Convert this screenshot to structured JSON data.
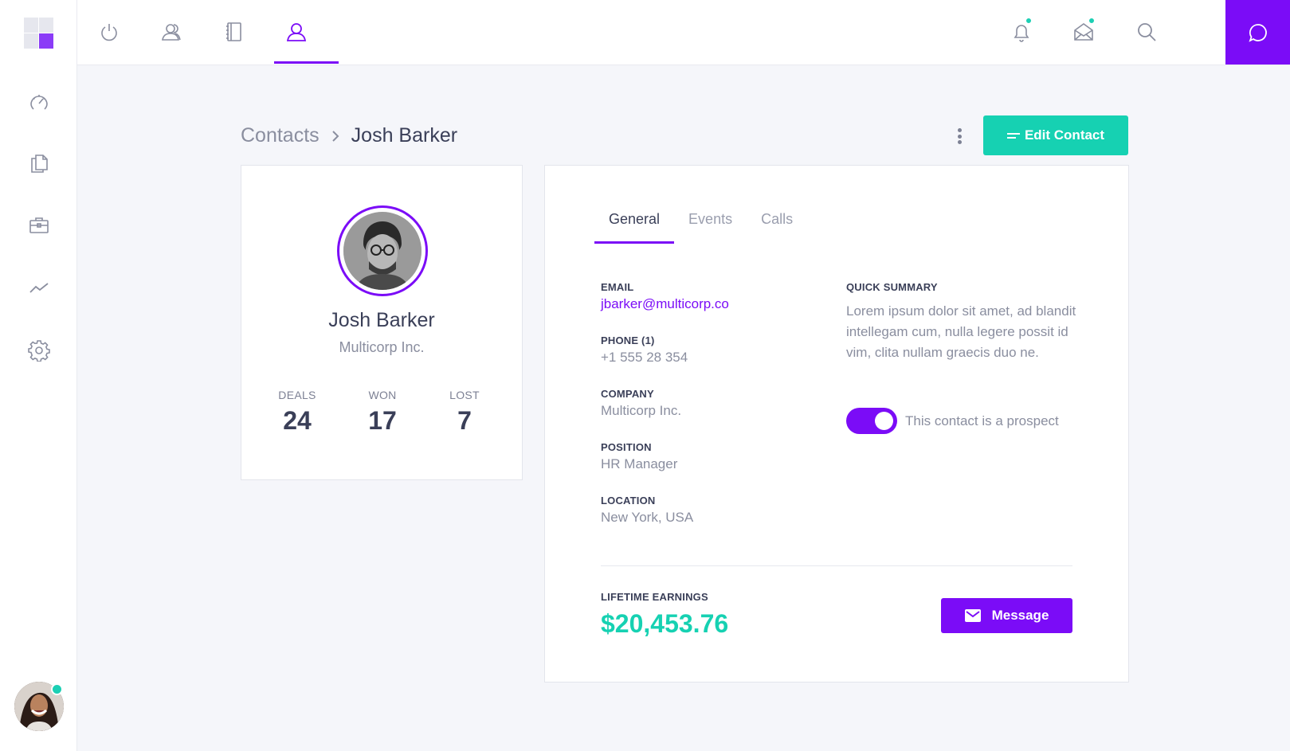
{
  "nav": {
    "sidebar_icons": [
      "dashboard-icon",
      "documents-icon",
      "briefcase-icon",
      "analytics-icon",
      "settings-icon"
    ],
    "top_icons": [
      "power-icon",
      "contacts-icon",
      "notebook-icon",
      "user-icon"
    ],
    "active_top": "user-icon"
  },
  "header": {
    "right_icons": [
      "bell-icon",
      "mail-icon",
      "search-icon"
    ],
    "chat_icon": "chat-icon"
  },
  "breadcrumb": {
    "parent": "Contacts",
    "current": "Josh Barker"
  },
  "actions": {
    "edit_label": "Edit Contact",
    "message_label": "Message"
  },
  "profile": {
    "name": "Josh Barker",
    "company": "Multicorp Inc.",
    "stats": [
      {
        "label": "DEALS",
        "value": "24"
      },
      {
        "label": "WON",
        "value": "17"
      },
      {
        "label": "LOST",
        "value": "7"
      }
    ]
  },
  "tabs": [
    "General",
    "Events",
    "Calls"
  ],
  "active_tab": "General",
  "details": {
    "email_label": "EMAIL",
    "email": "jbarker@multicorp.co",
    "phone_label": "PHONE (1)",
    "phone": "+1 555 28 354",
    "company_label": "COMPANY",
    "company": "Multicorp Inc.",
    "position_label": "POSITION",
    "position": "HR Manager",
    "location_label": "LOCATION",
    "location": "New York, USA"
  },
  "summary": {
    "label": "QUICK SUMMARY",
    "text": "Lorem ipsum dolor sit amet, ad blandit intellegam cum, nulla legere possit id vim, clita nullam graecis duo ne.",
    "prospect_label": "This contact is a prospect",
    "prospect_on": true
  },
  "earnings": {
    "label": "LIFETIME EARNINGS",
    "value": "$20,453.76"
  },
  "colors": {
    "accent": "#7b0cf7",
    "teal": "#16d1b2",
    "background": "#f5f6fa"
  }
}
